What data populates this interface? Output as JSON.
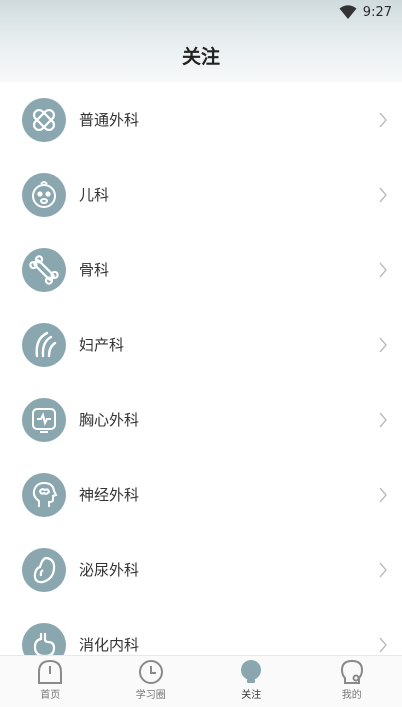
{
  "status_bar": {
    "time": "9:27"
  },
  "header": {
    "title": "关注"
  },
  "departments": [
    {
      "label": "普通外科",
      "icon": "bandage-icon"
    },
    {
      "label": "儿科",
      "icon": "baby-icon"
    },
    {
      "label": "骨科",
      "icon": "bone-icon"
    },
    {
      "label": "妇产科",
      "icon": "uterus-icon"
    },
    {
      "label": "胸心外科",
      "icon": "heart-monitor-icon"
    },
    {
      "label": "神经外科",
      "icon": "brain-head-icon"
    },
    {
      "label": "泌尿外科",
      "icon": "kidney-icon"
    },
    {
      "label": "消化内科",
      "icon": "stomach-icon"
    }
  ],
  "tabbar": {
    "items": [
      {
        "label": "首页",
        "icon": "home-icon"
      },
      {
        "label": "学习圈",
        "icon": "clock-icon"
      },
      {
        "label": "关注",
        "icon": "bulb-icon",
        "active": true
      },
      {
        "label": "我的",
        "icon": "user-icon"
      }
    ]
  },
  "colors": {
    "avatar_bg": "#8aa7b0",
    "header_top": "#cfdadc",
    "chevron": "#b5b5b5"
  }
}
